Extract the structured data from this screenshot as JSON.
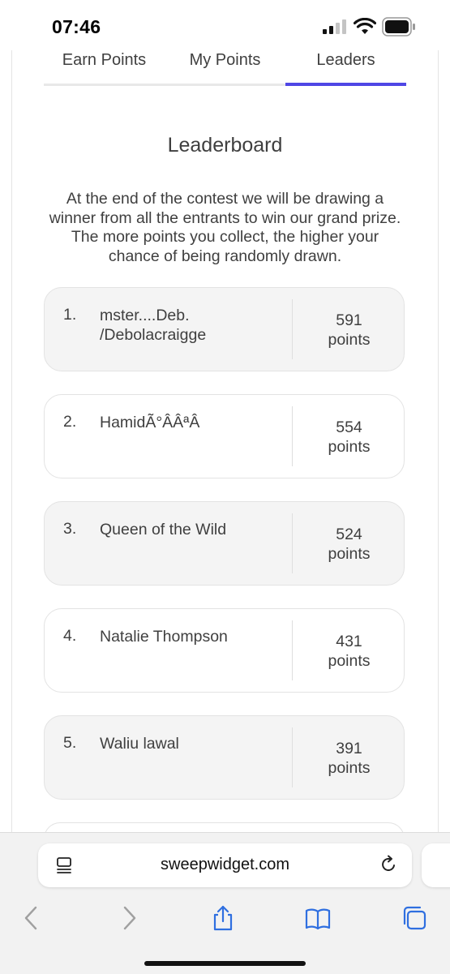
{
  "status_bar": {
    "time": "07:46",
    "signal_icon": "cellular-signal-icon",
    "wifi_icon": "wifi-icon",
    "battery_icon": "battery-icon"
  },
  "tabs": [
    {
      "label": "Earn Points",
      "active": false
    },
    {
      "label": "My Points",
      "active": false
    },
    {
      "label": "Leaders",
      "active": true
    }
  ],
  "accent_color": "#4f46e5",
  "leaderboard": {
    "title": "Leaderboard",
    "description": "At the end of the contest we will be drawing a winner from all the entrants to win our grand prize. The more points you collect, the higher your chance of being randomly drawn.",
    "entries": [
      {
        "rank": "1.",
        "name": "mster....Deb. /Debolacraigge",
        "points": "591",
        "unit": "points"
      },
      {
        "rank": "2.",
        "name": "HamidÃ°ÂÂªÂ",
        "points": "554",
        "unit": "points"
      },
      {
        "rank": "3.",
        "name": "Queen of the Wild",
        "points": "524",
        "unit": "points"
      },
      {
        "rank": "4.",
        "name": "Natalie Thompson",
        "points": "431",
        "unit": "points"
      },
      {
        "rank": "5.",
        "name": "Waliu lawal",
        "points": "391",
        "unit": "points"
      }
    ]
  },
  "browser": {
    "url": "sweepwidget.com",
    "reader_icon": "page-menu-icon",
    "reload_icon": "reload-icon",
    "back_icon": "back-chevron-icon",
    "forward_icon": "forward-chevron-icon",
    "share_icon": "share-icon",
    "bookmarks_icon": "bookmarks-icon",
    "tabs_icon": "tabs-icon"
  }
}
